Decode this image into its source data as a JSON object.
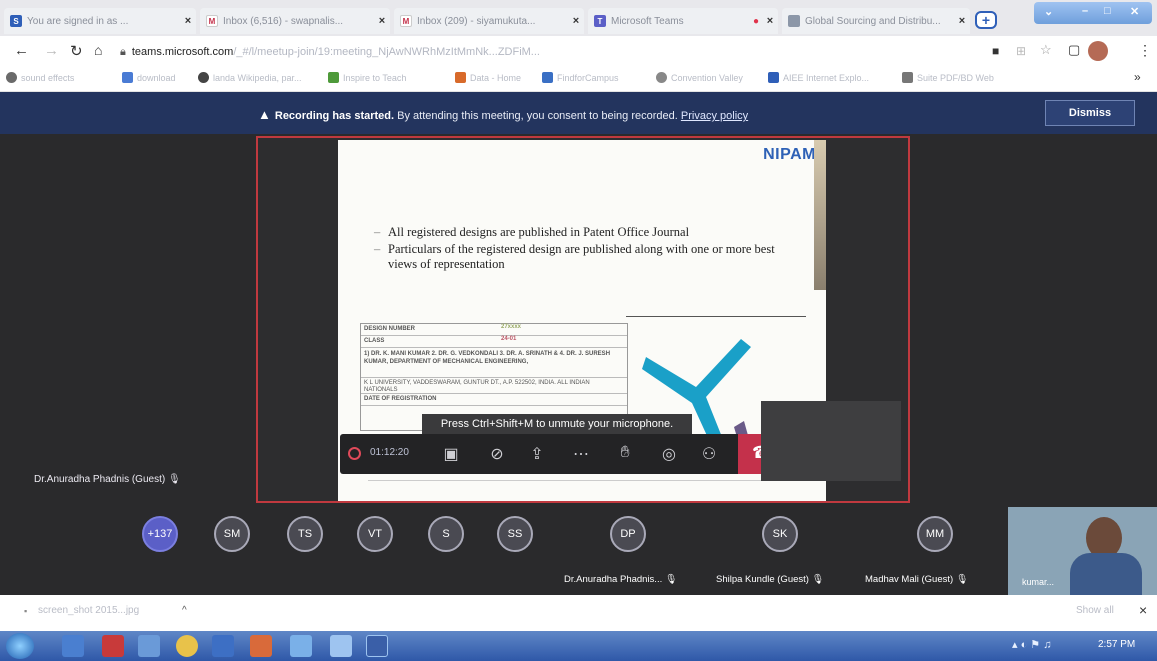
{
  "colors": {
    "accent_blue": "#2f5fb8",
    "banner": "#23345e",
    "hangup_red": "#c4314b",
    "share_border": "#c0393f",
    "nipam_blue": "#2e61b6"
  },
  "browser": {
    "tabs": [
      {
        "icon": "teams-s-icon",
        "icon_text": "S",
        "title": "You are signed in as ...",
        "close": "×"
      },
      {
        "icon": "gmail-icon",
        "icon_text": "M",
        "title": "Inbox (6,516) - swapnalis...",
        "close": "×"
      },
      {
        "icon": "gmail-icon",
        "icon_text": "M",
        "title": "Inbox (209) - siyamukuta...",
        "close": "×"
      },
      {
        "icon": "teams-icon",
        "icon_text": "T",
        "title": "Microsoft Teams",
        "close": "×"
      },
      {
        "icon": "globe-icon",
        "icon_text": "",
        "title": "Global Sourcing and Distribu...",
        "close": "×"
      }
    ],
    "new_tab": "+",
    "url_host": "teams.microsoft.com",
    "url_path": "/_#/l/meetup-join/19:meeting_NjAwNWRhMzItMmNk...ZDFiM...",
    "bookmarks": [
      "sound effects",
      "download",
      "landa Wikipedia, par...",
      "Inspire to Teach",
      "Data - Home",
      "FindforCampus",
      "Convention Valley",
      "AIEE Internet Explo...",
      "Suite PDF/BD Web"
    ],
    "bookmarks_more": "»",
    "download_file": "screen_shot 2015...jpg",
    "download_chevron": "^",
    "show_all": "Show all",
    "download_close": "×"
  },
  "meeting": {
    "banner_bold": "Recording has started.",
    "banner_text": "By attending this meeting, you consent to being recorded.",
    "banner_link": "Privacy policy",
    "dismiss": "Dismiss",
    "mic_message": "Press Ctrl+Shift+M to unmute your microphone.",
    "timer": "01:12:20",
    "presenter_name": "Dr.Anuradha Phadnis (Guest)",
    "participants": [
      {
        "initials": "+137"
      },
      {
        "initials": "SM"
      },
      {
        "initials": "TS"
      },
      {
        "initials": "VT"
      },
      {
        "initials": "S"
      },
      {
        "initials": "SS"
      },
      {
        "initials": "DP",
        "label": "Dr.Anuradha Phadnis..."
      },
      {
        "initials": "SK",
        "label": "Shilpa Kundle (Guest)"
      },
      {
        "initials": "MM",
        "label": "Madhav Mali (Guest)"
      }
    ],
    "camera_label": "kumar..."
  },
  "slide": {
    "logo": "NIPAM",
    "bullets": [
      "All registered designs are published in Patent Office Journal",
      "Particulars of the registered design are published  along with one or more best views of representation"
    ],
    "table": {
      "row1": "DESIGN NUMBER",
      "row1_val": "27xxxx",
      "row2": "CLASS",
      "row2_val": "24-01",
      "row3": "1) DR. K. MANI KUMAR 2. DR. G. VEDKONDALI 3. DR. A. SRINATH & 4. DR. J. SURESH KUMAR, DEPARTMENT OF MECHANICAL ENGINEERING,",
      "row4": "K L UNIVERSITY, VADDESWARAM, GUNTUR DT., A.P. 522502, INDIA. ALL INDIAN NATIONALS",
      "row5": "DATE OF REGISTRATION"
    }
  },
  "taskbar": {
    "time": "2:57 PM"
  }
}
